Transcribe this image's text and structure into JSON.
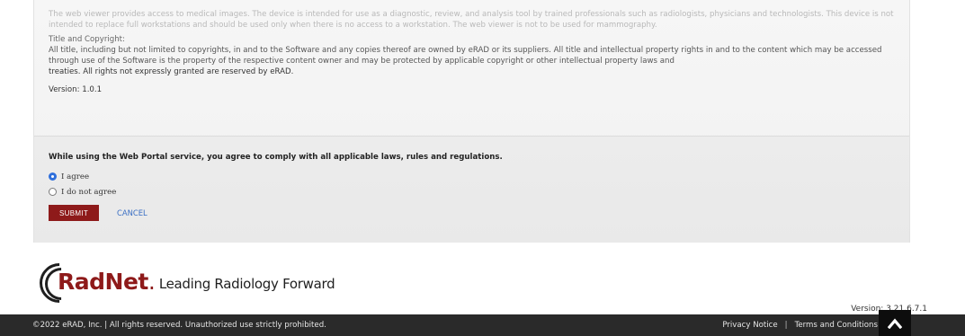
{
  "terms": {
    "disclaimer": "The web viewer provides access to medical images. The device is intended for use as a diagnostic, review, and analysis tool by trained professionals such as radiologists, physicians and technologists. This device is not intended to replace full workstations and should be used only when there is no access to a workstation. The web viewer is not to be used for mammography.",
    "copyright_heading": "Title and Copyright:",
    "copyright_body": "All title, including but not limited to copyrights, in and to the Software and any copies thereof are owned by eRAD or its suppliers. All title and intellectual property rights in and to the content which may be accessed through use of the Software is the property of the respective content owner and may be protected by applicable copyright or other intellectual property laws and",
    "copyright_tail": "treaties. All rights not expressly granted are reserved by eRAD.",
    "version": "Version: 1.0.1"
  },
  "agreement": {
    "title": "While using the Web Portal service, you agree to comply with all applicable laws, rules and regulations.",
    "options": [
      {
        "label": "I agree",
        "checked": true
      },
      {
        "label": "I do not agree",
        "checked": false
      }
    ],
    "submit_label": "SUBMIT",
    "cancel_label": "CANCEL"
  },
  "branding": {
    "logo_word": "RadNet",
    "tagline": "Leading Radiology Forward",
    "brand_color": "#8e1a1a"
  },
  "app_version": "Version: 3.21.6.7.1",
  "footer": {
    "copyright": "©2022 eRAD, Inc.  |  All rights reserved. Unauthorized use strictly prohibited.",
    "privacy": "Privacy Notice",
    "separator": "|",
    "terms": "Terms and Conditions",
    "scroll_icon": "chevron-up-icon"
  }
}
